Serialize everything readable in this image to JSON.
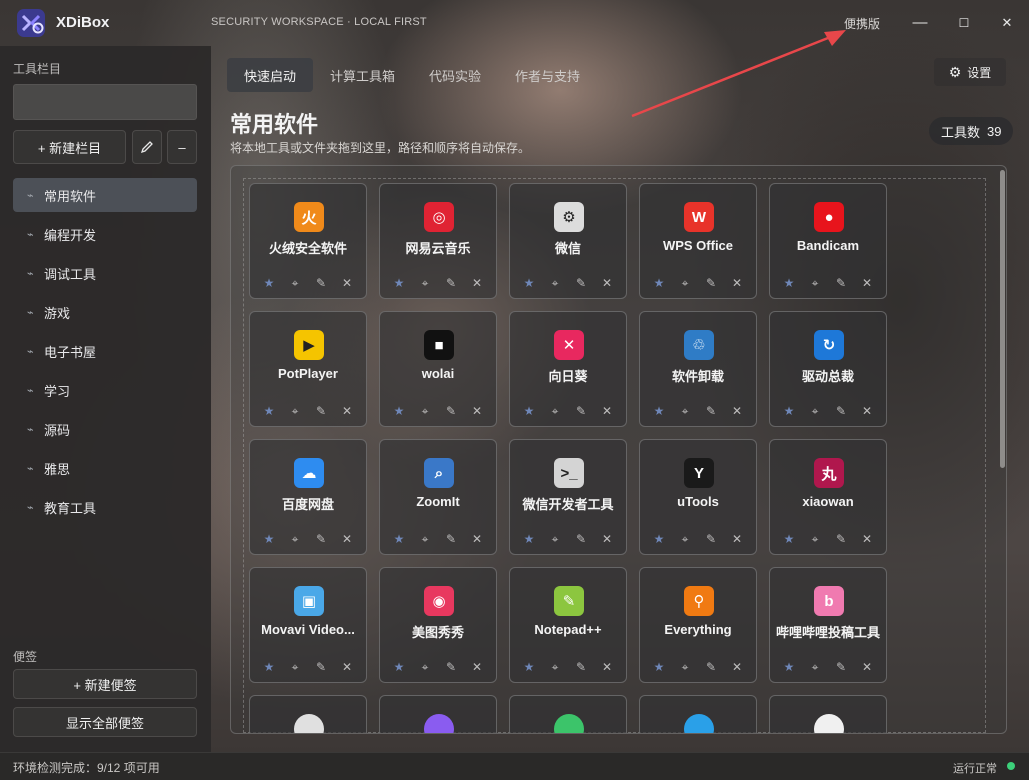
{
  "app": {
    "name": "XDiBox",
    "subtitle": "SECURITY WORKSPACE · LOCAL FIRST",
    "edition": "便携版",
    "window_controls": [
      "—",
      "☐",
      "✕"
    ]
  },
  "sidebar": {
    "section_title": "工具栏目",
    "new_column_label": "+ 新建栏目",
    "edit_icon": "pencil-icon",
    "remove_label": "–",
    "items": [
      {
        "label": "常用软件",
        "active": true
      },
      {
        "label": "编程开发"
      },
      {
        "label": "调试工具"
      },
      {
        "label": "游戏"
      },
      {
        "label": "电子书屋"
      },
      {
        "label": "学习"
      },
      {
        "label": "源码"
      },
      {
        "label": "雅思"
      },
      {
        "label": "教育工具"
      }
    ],
    "notes_title": "便签",
    "new_note_label": "+ 新建便签",
    "show_all_notes_label": "显示全部便签"
  },
  "tabs": [
    {
      "label": "快速启动",
      "active": true
    },
    {
      "label": "计算工具箱"
    },
    {
      "label": "代码实验"
    },
    {
      "label": "作者与支持"
    }
  ],
  "settings_label": "设置",
  "main": {
    "title": "常用软件",
    "description": "将本地工具或文件夹拖到这里，路径和顺序将自动保存。",
    "tool_count_label": "工具数",
    "tool_count": "39"
  },
  "card_actions": [
    "★",
    "⌖",
    "✎",
    "✕"
  ],
  "cards": [
    {
      "name": "火绒安全软件",
      "icon": "shield-icon",
      "glyph": "火",
      "color": "#f08a1a"
    },
    {
      "name": "网易云音乐",
      "icon": "music-icon",
      "glyph": "◎",
      "color": "#e02333"
    },
    {
      "name": "微信",
      "icon": "wechat-icon",
      "glyph": "⚙",
      "color": "#dcdcdc"
    },
    {
      "name": "WPS Office",
      "icon": "wps-icon",
      "glyph": "W",
      "color": "#e8332a"
    },
    {
      "name": "Bandicam",
      "icon": "record-icon",
      "glyph": "●",
      "color": "#e8141c"
    },
    {
      "name": "PotPlayer",
      "icon": "potplayer-icon",
      "glyph": "▶",
      "color": "#f5c400"
    },
    {
      "name": "wolai",
      "icon": "wolai-icon",
      "glyph": "■",
      "color": "#111111"
    },
    {
      "name": "向日葵",
      "icon": "sunflower-icon",
      "glyph": "✕",
      "color": "#e8285f"
    },
    {
      "name": "软件卸载",
      "icon": "trash-icon",
      "glyph": "♲",
      "color": "#2f7cc6"
    },
    {
      "name": "驱动总裁",
      "icon": "driver-icon",
      "glyph": "↻",
      "color": "#1e78d8"
    },
    {
      "name": "百度网盘",
      "icon": "cloud-icon",
      "glyph": "☁",
      "color": "#2e8cf0"
    },
    {
      "name": "ZoomIt",
      "icon": "zoom-icon",
      "glyph": "⌕",
      "color": "#3a78c8"
    },
    {
      "name": "微信开发者工具",
      "icon": "devtools-icon",
      "glyph": ">_",
      "color": "#d4d4d4"
    },
    {
      "name": "uTools",
      "icon": "utools-icon",
      "glyph": "Y",
      "color": "#1a1a1a"
    },
    {
      "name": "xiaowan",
      "icon": "xiaowan-icon",
      "glyph": "丸",
      "color": "#b0174d"
    },
    {
      "name": "Movavi Video...",
      "icon": "video-icon",
      "glyph": "▣",
      "color": "#4aa8e8"
    },
    {
      "name": "美图秀秀",
      "icon": "camera-icon",
      "glyph": "◉",
      "color": "#e8385f"
    },
    {
      "name": "Notepad++",
      "icon": "notepad-icon",
      "glyph": "✎",
      "color": "#8cc63f"
    },
    {
      "name": "Everything",
      "icon": "search-icon",
      "glyph": "⚲",
      "color": "#f07a12"
    },
    {
      "name": "哔哩哔哩投稿工具",
      "icon": "bilibili-icon",
      "glyph": "b",
      "color": "#f07ab0"
    }
  ],
  "partial_cards": [
    {
      "icon": "doc-icon",
      "color": "#e0e0e0"
    },
    {
      "icon": "purple-app-icon",
      "color": "#8a5cf0"
    },
    {
      "icon": "green-app-icon",
      "color": "#3cc46a"
    },
    {
      "icon": "blue-app-icon",
      "color": "#2aa0e8"
    },
    {
      "icon": "tiktok-icon",
      "color": "#f0f0f0"
    }
  ],
  "status": {
    "left": "环境检测完成：9/12 项可用",
    "right": "运行正常",
    "dot_color": "#3cd07a"
  }
}
